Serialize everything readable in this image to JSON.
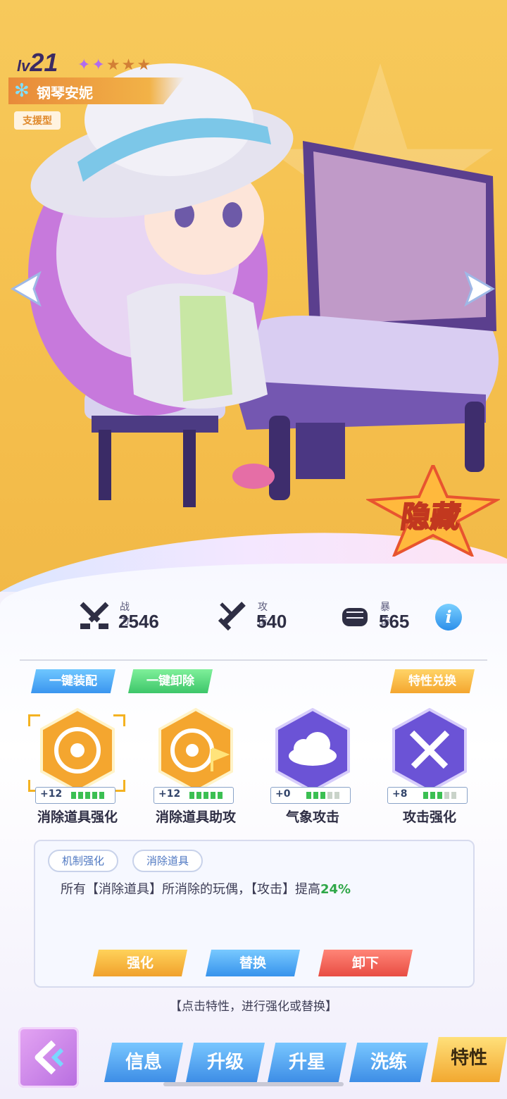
{
  "character": {
    "level_prefix": "lv",
    "level": "21",
    "stars_filled": 2,
    "stars_total": 5,
    "name": "钢琴安妮",
    "role": "支援型",
    "badge": "隐藏"
  },
  "stats": [
    {
      "label": "战力",
      "value": "2546",
      "icon": "crossed-swords-icon"
    },
    {
      "label": "攻击",
      "value": "540",
      "icon": "sword-icon"
    },
    {
      "label": "暴击",
      "value": "565",
      "icon": "fist-icon"
    }
  ],
  "actions_top": {
    "equip_all": "一键装配",
    "unequip_all": "一键卸除",
    "trait_exchange": "特性兑换"
  },
  "traits": [
    {
      "name": "消除道具强化",
      "level": "+12",
      "bars_on": 5,
      "bars_total": 5,
      "color": "#f4a62f",
      "icon": "swirl-icon"
    },
    {
      "name": "消除道具助攻",
      "level": "+12",
      "bars_on": 5,
      "bars_total": 5,
      "color": "#f4a62f",
      "icon": "swirl-flag-icon"
    },
    {
      "name": "气象攻击",
      "level": "+0",
      "bars_on": 3,
      "bars_total": 5,
      "color": "#6b53d6",
      "icon": "cloud-icon"
    },
    {
      "name": "攻击强化",
      "level": "+8",
      "bars_on": 3,
      "bars_total": 5,
      "color": "#6b53d6",
      "icon": "crossed-swords-icon"
    }
  ],
  "detail": {
    "tags": [
      "机制强化",
      "消除道具"
    ],
    "text_before": "所有【消除道具】所消除的玩偶，【攻击】提高",
    "highlight": "24%",
    "buttons": {
      "upgrade": "强化",
      "replace": "替换",
      "remove": "卸下"
    }
  },
  "hint": "【点击特性，进行强化或替换】",
  "tabs": [
    "信息",
    "升级",
    "升星",
    "洗练",
    "特性"
  ],
  "active_tab": "特性"
}
